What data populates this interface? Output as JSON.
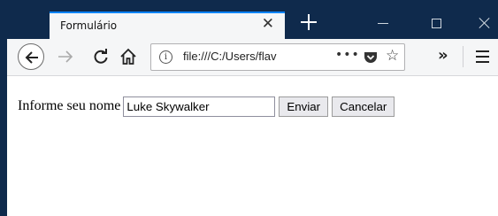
{
  "tab": {
    "title": "Formulário",
    "close_glyph": "✕"
  },
  "toolbar": {
    "url": "file:///C:/Users/flav",
    "info_glyph": "i",
    "more_glyph": "•••",
    "star_glyph": "☆",
    "overflow_glyph": "»"
  },
  "icons": {
    "back": "back-arrow-icon",
    "forward": "forward-arrow-icon",
    "reload": "reload-icon",
    "home": "home-icon",
    "pocket": "pocket-icon",
    "menu": "hamburger-menu-icon"
  },
  "form": {
    "label": "Informe seu nome",
    "name_value": "Luke Skywalker",
    "submit_label": "Enviar",
    "cancel_label": "Cancelar"
  },
  "colors": {
    "titlebar": "#0f2a4c",
    "tab_accent": "#0a84ff",
    "toolbar": "#f5f6f7"
  }
}
